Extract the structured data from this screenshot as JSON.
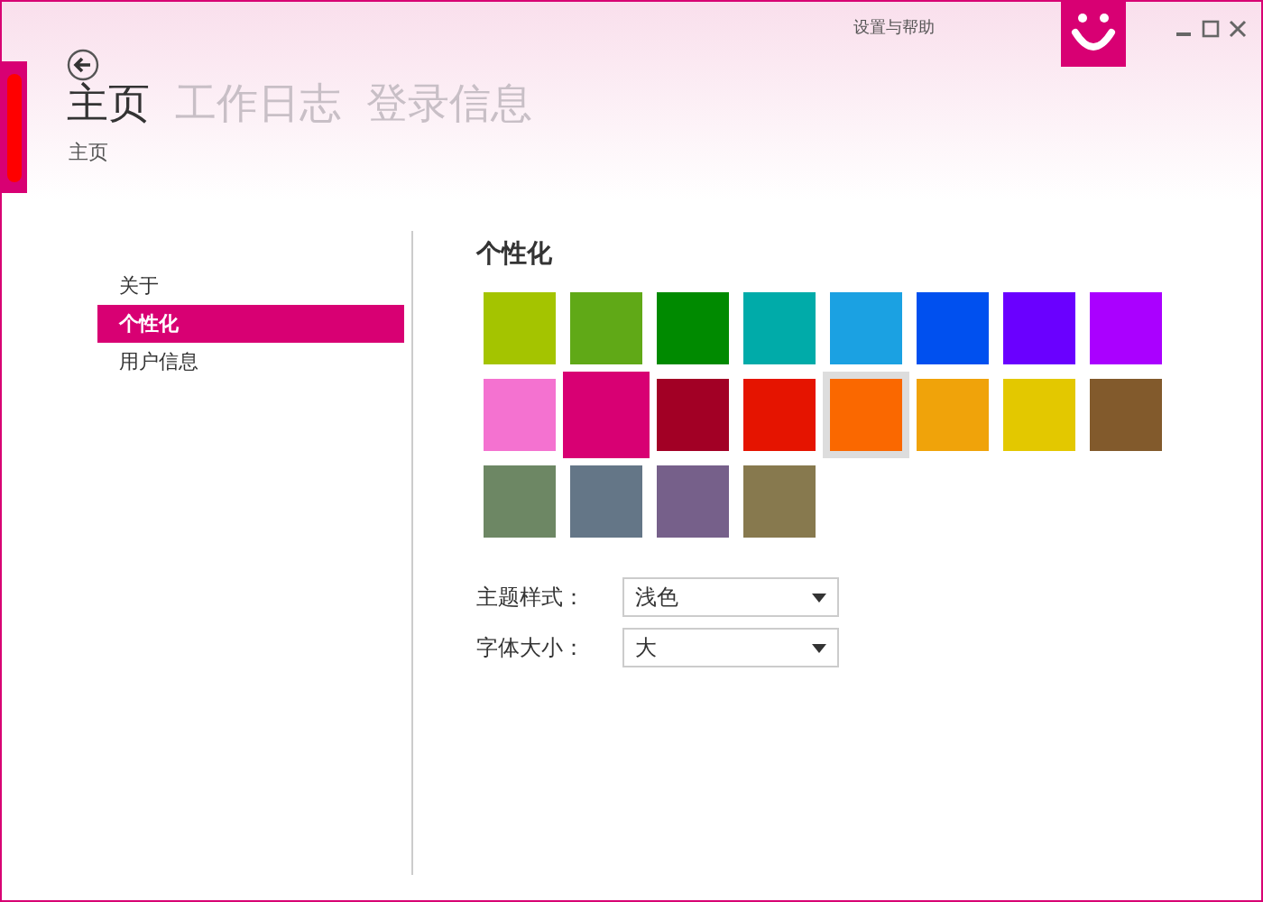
{
  "window": {
    "title": "设置与帮助"
  },
  "header": {
    "tabs": [
      {
        "label": "主页",
        "selected": true
      },
      {
        "label": "工作日志",
        "selected": false
      },
      {
        "label": "登录信息",
        "selected": false
      }
    ],
    "breadcrumb": "主页"
  },
  "sidebar": {
    "items": [
      {
        "label": "关于",
        "selected": false
      },
      {
        "label": "个性化",
        "selected": true
      },
      {
        "label": "用户信息",
        "selected": false
      }
    ]
  },
  "content": {
    "title": "个性化",
    "swatches": [
      {
        "color": "#a4c400",
        "selected": false,
        "highlighted": false
      },
      {
        "color": "#60a917",
        "selected": false,
        "highlighted": false
      },
      {
        "color": "#008a00",
        "selected": false,
        "highlighted": false
      },
      {
        "color": "#00aba9",
        "selected": false,
        "highlighted": false
      },
      {
        "color": "#1ba1e2",
        "selected": false,
        "highlighted": false
      },
      {
        "color": "#0050ef",
        "selected": false,
        "highlighted": false
      },
      {
        "color": "#6a00ff",
        "selected": false,
        "highlighted": false
      },
      {
        "color": "#aa00ff",
        "selected": false,
        "highlighted": false
      },
      {
        "color": "#f472d0",
        "selected": false,
        "highlighted": false
      },
      {
        "color": "#d80073",
        "selected": true,
        "highlighted": false
      },
      {
        "color": "#a20025",
        "selected": false,
        "highlighted": false
      },
      {
        "color": "#e51400",
        "selected": false,
        "highlighted": false
      },
      {
        "color": "#fa6800",
        "selected": false,
        "highlighted": true
      },
      {
        "color": "#f0a30a",
        "selected": false,
        "highlighted": false
      },
      {
        "color": "#e3c800",
        "selected": false,
        "highlighted": false
      },
      {
        "color": "#825a2c",
        "selected": false,
        "highlighted": false
      },
      {
        "color": "#6d8764",
        "selected": false,
        "highlighted": false
      },
      {
        "color": "#647687",
        "selected": false,
        "highlighted": false
      },
      {
        "color": "#76608a",
        "selected": false,
        "highlighted": false
      },
      {
        "color": "#87794e",
        "selected": false,
        "highlighted": false
      }
    ],
    "settings": [
      {
        "label": "主题样式：",
        "value": "浅色"
      },
      {
        "label": "字体大小：",
        "value": "大"
      }
    ]
  }
}
